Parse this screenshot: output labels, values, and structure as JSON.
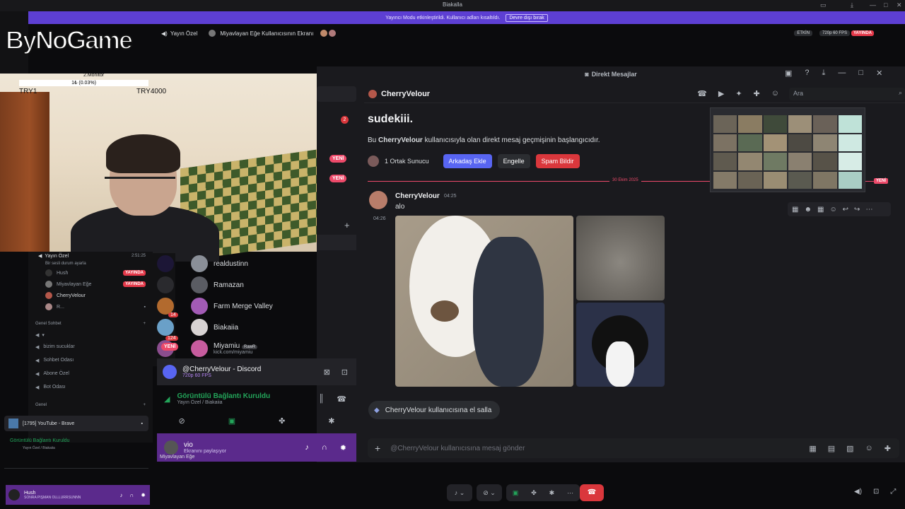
{
  "window": {
    "title": "Biakalla"
  },
  "banner": {
    "text": "Yayıncı Modu etkinleştirildi. Kullanıcı adları kısaltıldı.",
    "button": "Devre dışı bırak"
  },
  "voice_bar": {
    "channel": "Yayın Özel",
    "screen_title": "Miyavlayan Eğe Kullanıcısının Ekranı",
    "status": "ETKİN",
    "quality": "720p 60 FPS",
    "live": "YAYINDA"
  },
  "overlay": {
    "logo": "ByNoGame",
    "monitor": "2.Monitör",
    "meter": "1₺ (0.03%)",
    "left_label": "TRY1",
    "right_label": "TRY4000"
  },
  "dm": {
    "window_title": "Direkt Mesajlar",
    "user": "CherryVelour",
    "search_placeholder": "Ara",
    "intro_name": "sudekiii.",
    "intro_prefix": "Bu ",
    "intro_user": "CherryVelour",
    "intro_suffix": " kullanıcısıyla olan direkt mesaj geçmişinin başlangıcıdır.",
    "mutual": "1 Ortak Sunucu",
    "add_friend": "Arkadaş Ekle",
    "block": "Engelle",
    "report": "Spam Bildir",
    "date_divider": "30 Ekim 2025",
    "new_label": "YENİ",
    "msg_author": "CherryVelour",
    "msg_time": "04:25",
    "msg_text": "alo",
    "msg2_time": "04:26",
    "wave": "CherryVelour kullanıcısına el salla",
    "input_placeholder": "@CherryVelour kullanıcısına mesaj gönder"
  },
  "server_badges": {
    "unread": "2",
    "new1": "YENİ",
    "new2": "YENİ",
    "mention14": "14",
    "mention124": "124",
    "new3": "YENİ"
  },
  "servers": [
    {
      "name": "realdustinn",
      "color": "#8a8f98"
    },
    {
      "name": "Ramazan",
      "color": "#5a5c63"
    },
    {
      "name": "Farm Merge Valley",
      "color": "#a25bb5"
    },
    {
      "name": "Biakaiia",
      "color": "#d8d3d3"
    },
    {
      "name": "Miyamiu",
      "sub": "kick.com/miyamiu",
      "tag": "RawR",
      "color": "#c75c9e"
    }
  ],
  "stream_panel": {
    "title": "@CherryVelour - Discord",
    "quality": "720p 60 FPS",
    "conn": "Görüntülü Bağlantı Kuruldu",
    "conn_sub": "Yayın Özel / Biakaiia",
    "user": "vio",
    "user_sub": "Ekranını paylaşıyor",
    "viewer": "Miyavlayan Eğe"
  },
  "left_channels": {
    "voice_title": "Yayın Özel",
    "voice_time": "2:51:25",
    "voice_sub": "Bir sesli durum ayarla",
    "members": [
      {
        "name": "Hush",
        "live": "YAYINDA"
      },
      {
        "name": "Miyavlayan Eğe",
        "live": "YAYINDA"
      },
      {
        "name": "CherryVelour",
        "live": ""
      },
      {
        "name": "R...",
        "live": ""
      }
    ],
    "cat1": "Genel Sohbet",
    "channels": [
      "bizim sucuklar",
      "Sohbet Odası",
      "Abone Özel",
      "Bot Odası"
    ],
    "cat2": "Genel",
    "brave": "[1795] YouTube - Brave",
    "conn": "Görüntülü Bağlantı Kuruldu",
    "conn_sub": "Yayın Özel / Biakaiia",
    "user": "Hush",
    "user_sub": "SONRA PIŞMAN OLLLURRSUNNN"
  },
  "colors": {
    "blurple": "#5865f2",
    "red": "#da373c",
    "purple": "#5d3fd3",
    "green": "#23a55a"
  }
}
